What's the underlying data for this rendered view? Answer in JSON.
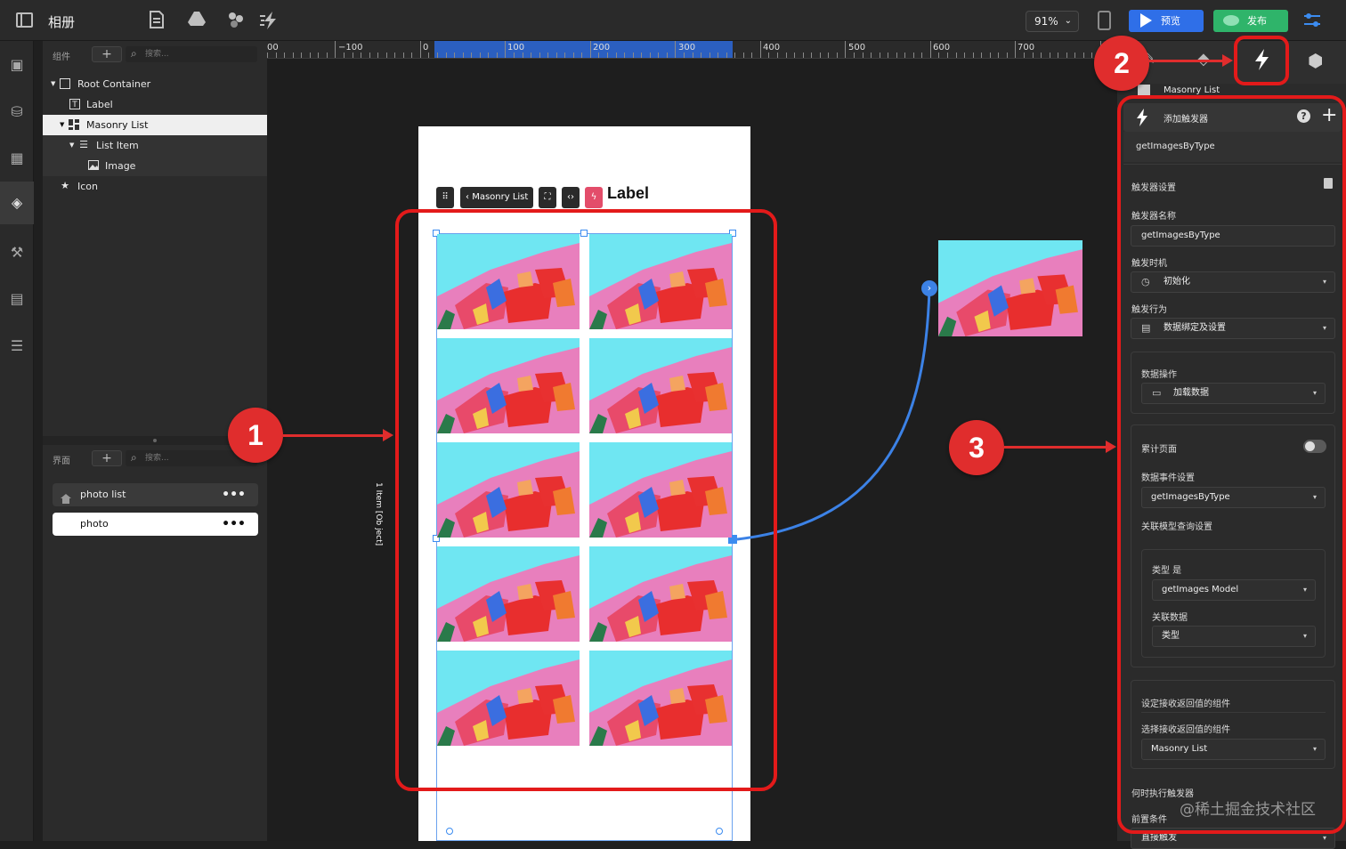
{
  "app": {
    "title": "相册"
  },
  "topbar": {
    "zoom": "91%",
    "preview_label": "预览",
    "publish_label": "发布"
  },
  "components_panel": {
    "label": "组件",
    "search_placeholder": "搜索...",
    "tree": [
      {
        "label": "Root Container",
        "icon": "checkbox-icon"
      },
      {
        "label": "Label",
        "icon": "text-icon"
      },
      {
        "label": "Masonry List",
        "icon": "masonry-icon"
      },
      {
        "label": "List Item",
        "icon": "list-item-icon"
      },
      {
        "label": "Image",
        "icon": "image-icon"
      },
      {
        "label": "Icon",
        "icon": "star-icon"
      }
    ]
  },
  "pages_panel": {
    "label": "界面",
    "search_placeholder": "搜索...",
    "pages": [
      {
        "label": "photo list"
      },
      {
        "label": "photo"
      }
    ]
  },
  "ruler": {
    "labels": [
      "00",
      "−100",
      "0",
      "100",
      "200",
      "300",
      "400",
      "500",
      "600",
      "700"
    ]
  },
  "canvas": {
    "toolbar_label": "Masonry List",
    "label_text": "Label",
    "vertical_text": "1 Item [Ob ject]"
  },
  "annotations": {
    "badge1": "1",
    "badge2": "2",
    "badge3": "3"
  },
  "right_panel": {
    "selected_component": "Masonry List",
    "add_trigger": "添加触发器",
    "trigger_name_header": "getImagesByType",
    "trigger_settings": "触发器设置",
    "trigger_name_label": "触发器名称",
    "trigger_name_value": "getImagesByType",
    "trigger_timing_label": "触发时机",
    "trigger_timing_value": "初始化",
    "trigger_action_label": "触发行为",
    "trigger_action_value": "数据绑定及设置",
    "data_op_label": "数据操作",
    "data_op_value": "加载数据",
    "accumulate_label": "累计页面",
    "data_event_label": "数据事件设置",
    "data_event_value": "getImagesByType",
    "query_label": "关联模型查询设置",
    "type_is_label": "类型 是",
    "model_value": "getImages Model",
    "related_data_label": "关联数据",
    "related_data_value": "类型",
    "set_receive_label": "设定接收返回值的组件",
    "choose_receive_label": "选择接收返回值的组件",
    "receive_value": "Masonry List",
    "when_exec_label": "何时执行触发器",
    "precondition_label": "前置条件",
    "direct_trigger": "直接触发"
  },
  "watermark": "@稀土掘金技术社区"
}
